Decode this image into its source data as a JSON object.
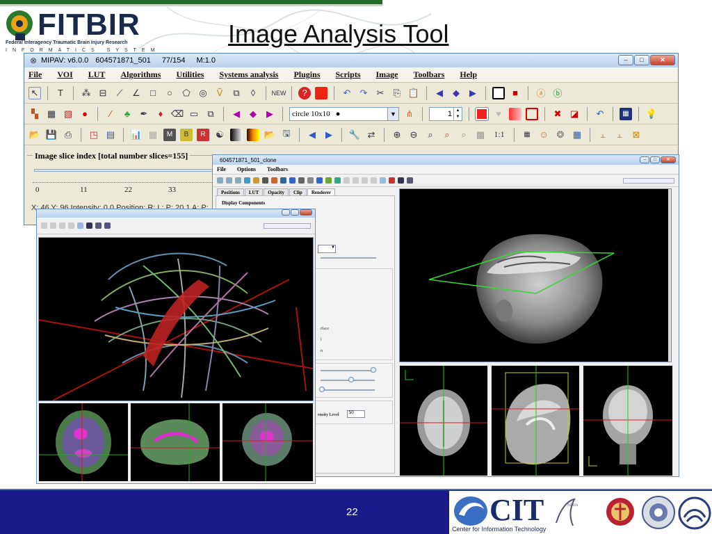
{
  "header": {
    "logo_text": "FITBIR",
    "logo_subtitle": "Federal Interagency Traumatic Brain Injury Research",
    "logo_subtitle2": "INFORMATICS SYSTEM",
    "slide_title": "Image Analysis Tool"
  },
  "main_window": {
    "title_app": "MIPAV:  v6.0.0",
    "title_file": "604571871_501",
    "title_slice": "77/154",
    "title_mode": "M:1.0",
    "menu": [
      "File",
      "VOI",
      "LUT",
      "Algorithms",
      "Utilities",
      "Systems analysis",
      "Plugins",
      "Scripts",
      "Image",
      "Toolbars",
      "Help"
    ],
    "brush_select": "circle 10x10",
    "spinner_value": "1",
    "ratio_label": "1:1",
    "slice_label": "Image slice index  [total number slices=155]",
    "ticks": [
      "0",
      "11",
      "22",
      "33"
    ],
    "status_text": "X: 46  Y: 96  Intensity: 0.0  Position: R: L: P: 20.1 A: P:"
  },
  "clone_window": {
    "title": "604571871_501_clone",
    "menu": [
      "File",
      "Options",
      "Toolbars"
    ],
    "tabs": [
      "Positions",
      "LUT",
      "Opacity",
      "Clip",
      "Renderer"
    ],
    "selected_tab": "Renderer",
    "display_components_label": "Display Components",
    "surface_label": "rface",
    "label_n": "n",
    "label_l": "l",
    "intensity_label": "ensity Level",
    "intensity_value": "50"
  },
  "footer": {
    "page_number": "22",
    "cit_text": "CIT",
    "cit_subtitle": "Center for Information Technology"
  },
  "colors": {
    "footer_bg": "#1a1a8a",
    "title_bar": "#b9d1ee",
    "window_bg": "#ece9d8"
  }
}
